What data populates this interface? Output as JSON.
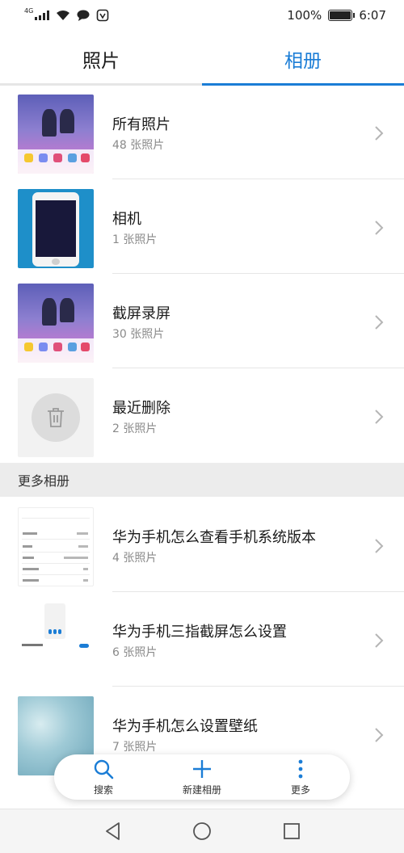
{
  "status_bar": {
    "network_tag": "4G",
    "battery_percent": "100%",
    "battery_level": 1.0,
    "time": "6:07"
  },
  "tabs": [
    {
      "label": "照片",
      "active": false
    },
    {
      "label": "相册",
      "active": true
    }
  ],
  "albums": [
    {
      "title": "所有照片",
      "count": "48 张照片",
      "thumb": "screenshot-wallpaper"
    },
    {
      "title": "相机",
      "count": "1 张照片",
      "thumb": "phone-photo"
    },
    {
      "title": "截屏录屏",
      "count": "30 张照片",
      "thumb": "screenshot-wallpaper"
    },
    {
      "title": "最近删除",
      "count": "2 张照片",
      "thumb": "trash-icon"
    }
  ],
  "more_section": {
    "heading": "更多相册",
    "albums": [
      {
        "title": "华为手机怎么查看手机系统版本",
        "count": "4 张照片",
        "thumb": "settings-screenshot"
      },
      {
        "title": "华为手机三指截屏怎么设置",
        "count": "6 张照片",
        "thumb": "cards-screenshot"
      },
      {
        "title": "华为手机怎么设置壁纸",
        "count": "7 张照片",
        "thumb": "water-wallpaper"
      }
    ]
  },
  "bottom_actions": [
    {
      "label": "搜索",
      "icon": "search-icon"
    },
    {
      "label": "新建相册",
      "icon": "plus-icon"
    },
    {
      "label": "更多",
      "icon": "more-vertical-icon"
    }
  ],
  "nav_bar": {
    "buttons": [
      "back-triangle-icon",
      "home-circle-icon",
      "recents-square-icon"
    ]
  },
  "colors": {
    "accent": "#1b7dd6",
    "secondary_text": "#8a8a8a",
    "section_bg": "#ececec"
  }
}
